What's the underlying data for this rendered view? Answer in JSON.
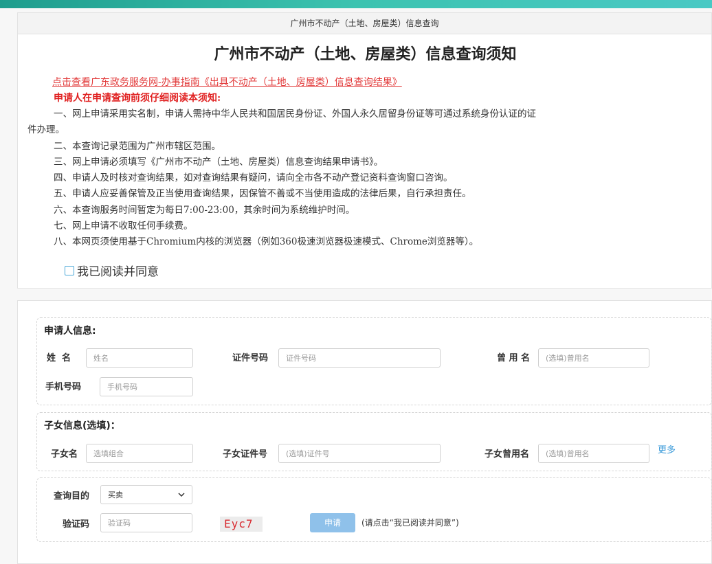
{
  "header": {
    "bar_title": "广州市不动产（土地、房屋类）信息查询"
  },
  "notice": {
    "title": "广州市不动产（土地、房屋类）信息查询须知",
    "guide_link": "点击查看广东政务服务网-办事指南《出具不动产（土地、房屋类）信息查询结果》",
    "intro": "申请人在申请查询前须仔细阅读本须知:",
    "rules": [
      "一、网上申请采用实名制，申请人需持中华人民共和国居民身份证、外国人永久居留身份证等可通过系统身份认证的证",
      "件办理。",
      "二、本查询记录范围为广州市辖区范围。",
      "三、网上申请必须填写《广州市不动产（土地、房屋类）信息查询结果申请书》。",
      "四、申请人及时核对查询结果，如对查询结果有疑问，请向全市各不动产登记资料查询窗口咨询。",
      "五、申请人应妥善保管及正当使用查询结果，因保管不善或不当使用造成的法律后果，自行承担责任。",
      "六、本查询服务时间暂定为每日7:00-23:00，其余时间为系统维护时间。",
      "七、网上申请不收取任何手续费。",
      "八、本网页须使用基于Chromium内核的浏览器（例如360极速浏览器极速模式、Chrome浏览器等）。"
    ],
    "agree_label": "我已阅读并同意"
  },
  "applicant": {
    "section_title": "申请人信息:",
    "name_label": "姓  名",
    "name_placeholder": "姓名",
    "id_label": "证件号码",
    "id_placeholder": "证件号码",
    "former_label": "曾 用 名",
    "former_placeholder": "(选填)曾用名",
    "phone_label": "手机号码",
    "phone_placeholder": "手机号码"
  },
  "children": {
    "section_title": "子女信息(选填)：",
    "name_label": "子女名",
    "name_placeholder": "选填组合",
    "id_label": "子女证件号",
    "id_placeholder": "(选填)证件号",
    "former_label": "子女曾用名",
    "former_placeholder": "(选填)曾用名",
    "more_link": "更多"
  },
  "query": {
    "purpose_label": "查询目的",
    "purpose_value": "买卖",
    "captcha_label": "验证码",
    "captcha_placeholder": "验证码",
    "captcha_text": "Eyc7",
    "apply_button": "申请",
    "hint": "(请点击“我已阅读并同意”)"
  },
  "colors": {
    "accent": "#3cc3b0",
    "link_red": "#e23a3a",
    "captcha_red": "#d8292f",
    "button_blue": "#8fc1ea",
    "more_blue": "#3a9ad9"
  }
}
